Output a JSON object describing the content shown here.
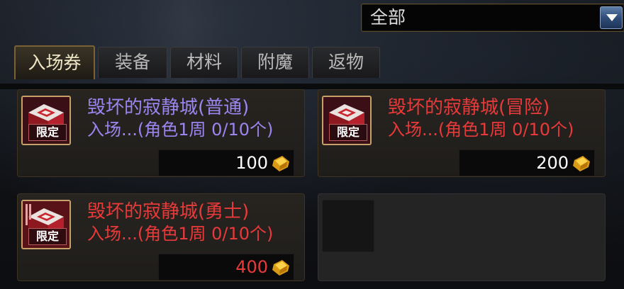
{
  "filter": {
    "selected": "全部"
  },
  "tabs": [
    {
      "label": "入场券",
      "active": true
    },
    {
      "label": "装备",
      "active": false
    },
    {
      "label": "材料",
      "active": false
    },
    {
      "label": "附魔",
      "active": false
    },
    {
      "label": "返物",
      "active": false
    }
  ],
  "items": [
    {
      "title": "毁坏的寂静城(普通)",
      "desc": "入场...(角色1周 0/10个)",
      "limit": "限定",
      "price": "100",
      "title_color": "#9b86f0",
      "price_color": "#ffffff"
    },
    {
      "title": "毁坏的寂静城(冒险)",
      "desc": "入场...(角色1周 0/10个)",
      "limit": "限定",
      "price": "200",
      "title_color": "#e83a3a",
      "price_color": "#ffffff"
    },
    {
      "title": "毁坏的寂静城(勇士)",
      "desc": "入场...(角色1周 0/10个)",
      "limit": "限定",
      "price": "400",
      "title_color": "#e83a3a",
      "price_color": "#e83a3a"
    }
  ],
  "icons": {
    "item": "ticket-box-icon",
    "currency": "gold-coin-icon",
    "dropdown": "chevron-down-icon"
  }
}
